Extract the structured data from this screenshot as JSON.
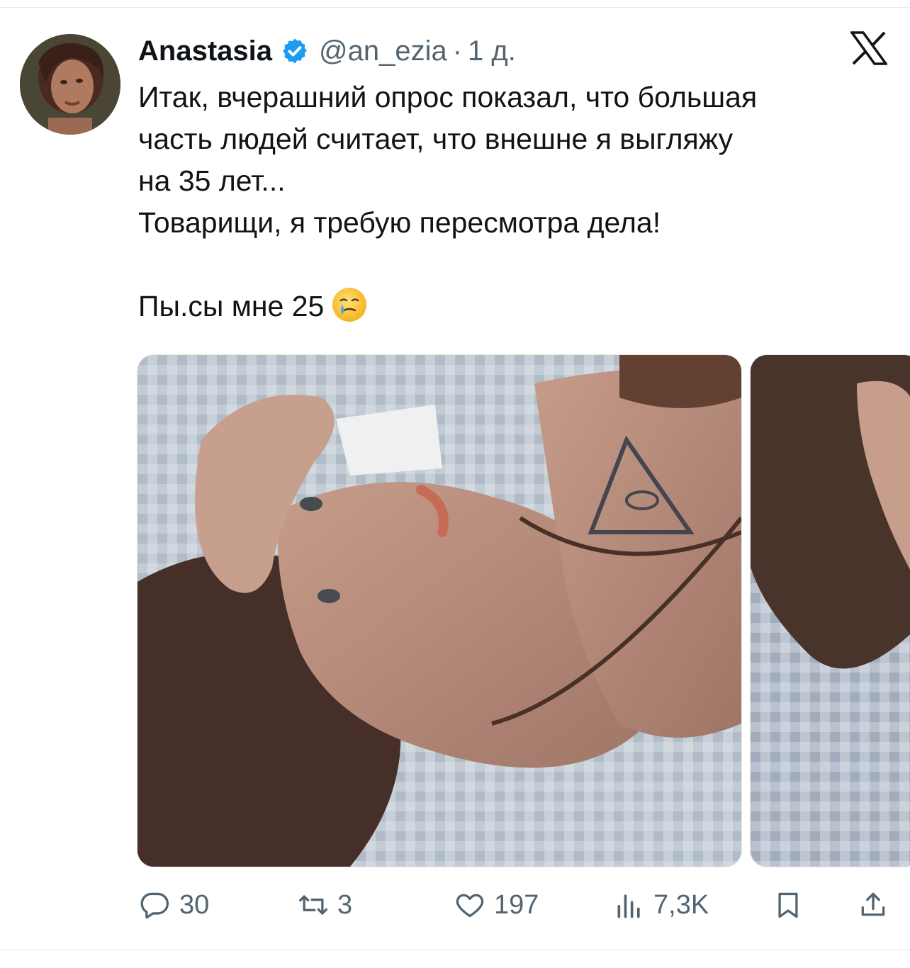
{
  "tweet": {
    "author_name": "Anastasia",
    "handle": "@an_ezia",
    "separator": "·",
    "time": "1 д.",
    "lines": [
      "Итак, вчерашний опрос показал, что большая",
      "часть людей считает, что внешне я выгляжу",
      "на 35 лет...",
      "Товарищи, я требую пересмотра дела!",
      "Пы.сы мне 25"
    ],
    "emoji": "crying-smile-emoji"
  },
  "metrics": {
    "replies": "30",
    "reposts": "3",
    "likes": "197",
    "views": "7,3K"
  },
  "icons": {
    "verified": "verified-badge-icon",
    "brand": "x-logo-icon",
    "reply": "reply-icon",
    "repost": "repost-icon",
    "like": "heart-icon",
    "views": "views-icon",
    "bookmark": "bookmark-icon",
    "share": "share-icon"
  },
  "colors": {
    "text_primary": "#0f1419",
    "text_secondary": "#536471",
    "verified_blue": "#1d9bf0",
    "divider": "#e6e8ea"
  }
}
